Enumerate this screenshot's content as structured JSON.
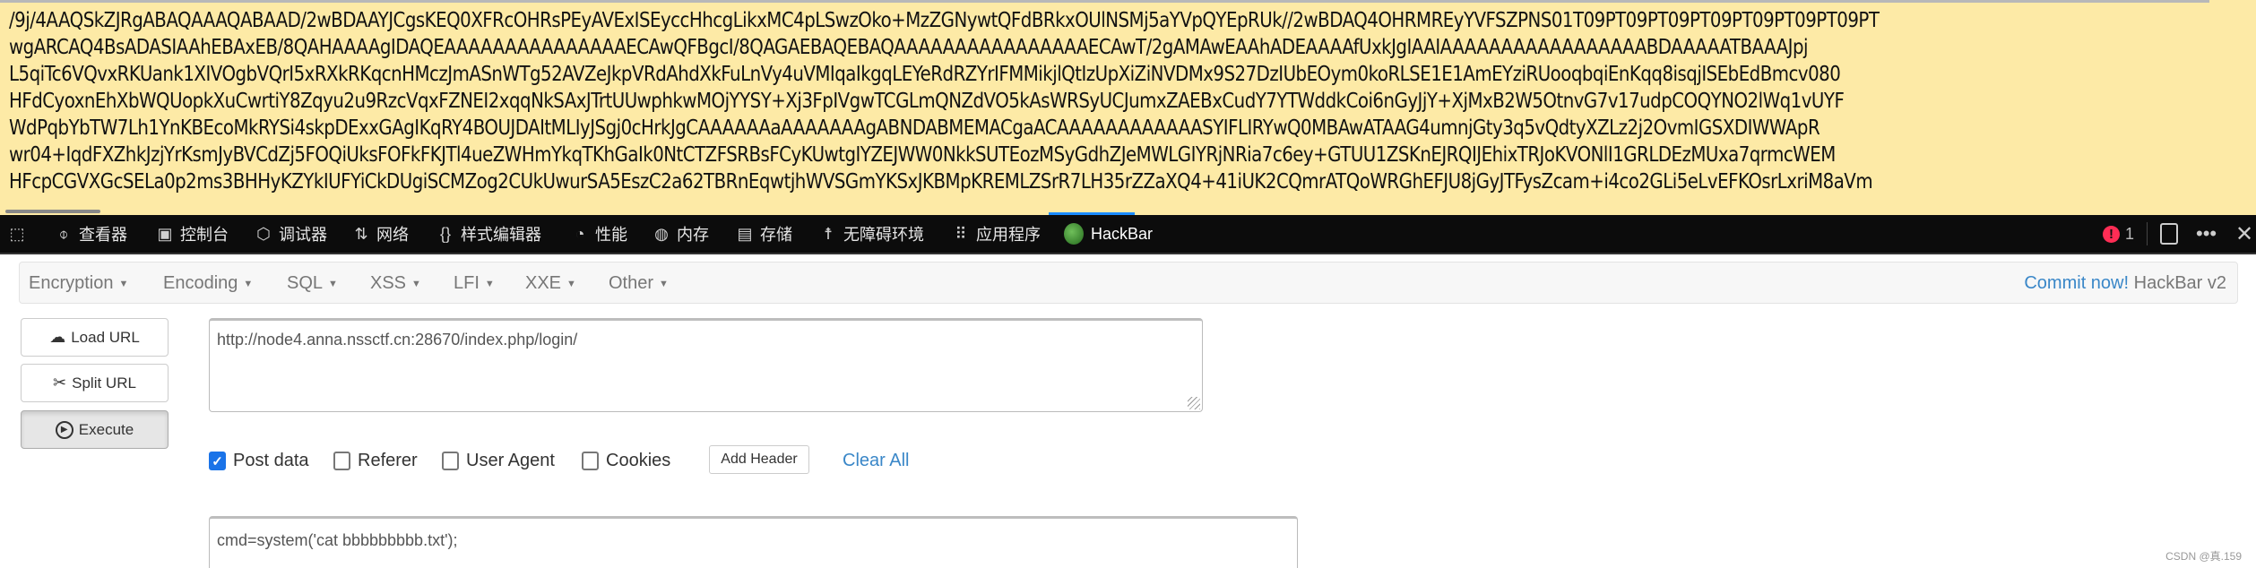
{
  "page_content": {
    "base64_lines": [
      "/9j/4AAQSkZJRgABAQAAAQABAAD/2wBDAAYJCgsKEQ0XFRcOHRsPEyAVExISEyccHhcgLikxMC4pLSwzOko+MzZGNywtQFdBRkxOUlNSMj5aYVpQYEpRUk//2wBDAQ4OHRMREyYVFSZPNS01T09PT09PT09PT09PT09PT09PT09PT",
      "wgARCAQ4BsADASIAAhEBAxEB/8QAHAAAAgIDAQEAAAAAAAAAAAAAAAECAwQFBgcI/8QAGAEBAQEBAQAAAAAAAAAAAAAAAAECAwT/2gAMAwEAAhADEAAAAfUxkJgIAAIAAAAAAAAAAAAAAAAABDAAAAATBAAAJpj",
      "L5qiTc6VQvxRKUank1XIVOgbVQrI5xRXkRKqcnHMczJmASnWTg52AVZeJkpVRdAhdXkFuLnVy4uVMIqaIkgqLEYeRdRZYrIFMMikjlQtIzUpXiZiNVDMx9S27DzIUbEOym0koRLSE1E1AmEYziRUooqbqiEnKqq8isqjISEbEdBmcv080",
      "HFdCyoxnEhXbWQUopkXuCwrtiY8Zqyu2u9RzcVqxFZNEI2xqqNkSAxJTrtUUwphkwMOjYYSY+Xj3FpIVgwTCGLmQNZdVO5kAsWRSyUCJumxZAEBxCudY7YTWddkCoi6nGyJjY+XjMxB2W5OtnvG7v17udpCOQYNO2lWq1vUYF",
      "WdPqbYbTW7Lh1YnKBEcoMkRYSi4skpDExxGAgIKqRY4BOUJDAItMLIyJSgj0cHrkJgCAAAAAAaAAAAAAAgABNDABMEMACgaACAAAAAAAAAAAASYIFLIRYwQ0MBAwATAAG4umnjGty3q5vQdtyXZLz2j2OvmIGSXDIWWApR",
      "wr04+IqdFXZhkJzjYrKsmJyBVCdZj5FOQiUksFOFkFKJTl4ueZWHmYkqTKhGaIk0NtCTZFSRBsFCyKUwtgIYZEJWW0NkkSUTEozMSyGdhZJeMWLGIYRjNRia7c6ey+GTUU1ZSKnEJRQIJEhixTRJoKVONlI1GRLDEzMUxa7qrmcWEM",
      "HFcpCGVXGcSELa0p2ms3BHHyKZYkIUFYiCkDUgiSCMZog2CUkUwurSA5EszC2a62TBRnEqwtjhWVSGmYKSxJKBMpKREMLZSrR7LH35rZZaXQ4+41iUK2CQmrATQoWRGhEFJU8jGyJTFysZcam+i4co2GLi5eLvEFKOsrLxriM8aVm"
    ]
  },
  "devtools": {
    "tabs": [
      {
        "label": "查看器",
        "icon": "inspector-icon"
      },
      {
        "label": "控制台",
        "icon": "console-icon"
      },
      {
        "label": "调试器",
        "icon": "debugger-icon"
      },
      {
        "label": "网络",
        "icon": "network-icon"
      },
      {
        "label": "样式编辑器",
        "icon": "style-editor-icon"
      },
      {
        "label": "性能",
        "icon": "performance-icon"
      },
      {
        "label": "内存",
        "icon": "memory-icon"
      },
      {
        "label": "存储",
        "icon": "storage-icon"
      },
      {
        "label": "无障碍环境",
        "icon": "accessibility-icon"
      },
      {
        "label": "应用程序",
        "icon": "application-icon"
      },
      {
        "label": "HackBar",
        "icon": "hackbar-icon"
      }
    ],
    "error_count": "1",
    "error_color": "#ff2d55"
  },
  "hackbar": {
    "menus": [
      "Encryption",
      "Encoding",
      "SQL",
      "XSS",
      "LFI",
      "XXE",
      "Other"
    ],
    "commit_link": "Commit now!",
    "version": "HackBar v2",
    "buttons": {
      "load_url": "Load URL",
      "split_url": "Split URL",
      "execute": "Execute"
    },
    "url_value": "http://node4.anna.nssctf.cn:28670/index.php/login/",
    "options": [
      {
        "label": "Post data",
        "checked": true
      },
      {
        "label": "Referer",
        "checked": false
      },
      {
        "label": "User Agent",
        "checked": false
      },
      {
        "label": "Cookies",
        "checked": false
      }
    ],
    "add_header": "Add Header",
    "clear_all": "Clear All",
    "post_value": "cmd=system('cat bbbbbbbbb.txt');",
    "accent_color": "#3a87c8"
  },
  "watermark": "CSDN @真.159"
}
